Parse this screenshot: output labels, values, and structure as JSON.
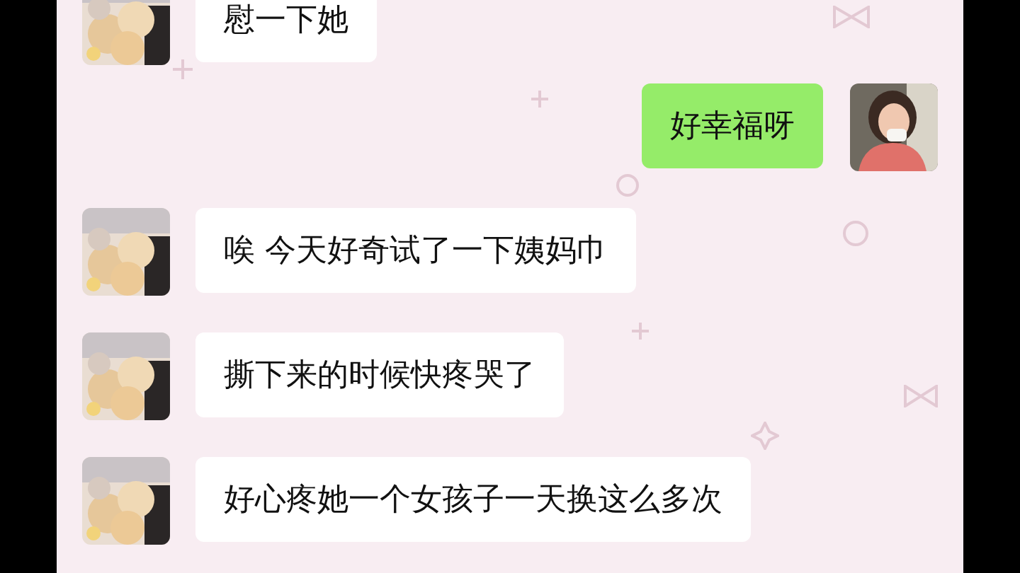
{
  "messages": [
    {
      "kind": "incoming",
      "text": "慰一下她"
    },
    {
      "kind": "outgoing",
      "text": "好幸福呀"
    },
    {
      "kind": "incoming",
      "text": "唉 今天好奇试了一下姨妈巾"
    },
    {
      "kind": "incoming",
      "text": "撕下来的时候快疼哭了"
    },
    {
      "kind": "incoming",
      "text": "好心疼她一个女孩子一天换这么多次"
    }
  ]
}
